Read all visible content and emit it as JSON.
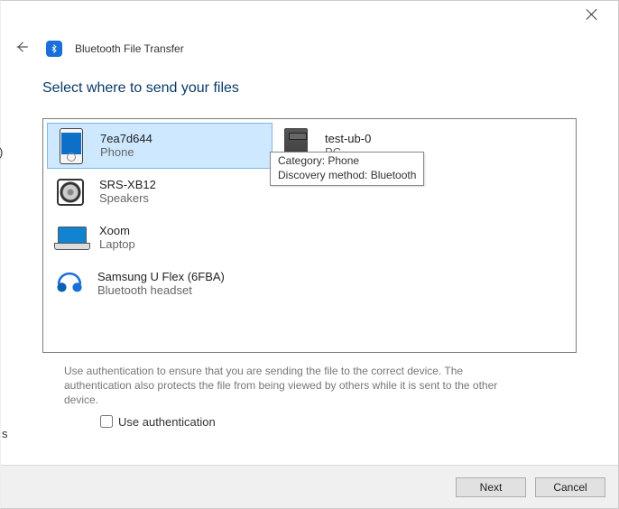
{
  "window_title": "Bluetooth File Transfer",
  "heading": "Select where to send your files",
  "devices": [
    {
      "name": "7ea7d644",
      "type": "Phone",
      "icon": "phone",
      "selected": true
    },
    {
      "name": "SRS-XB12",
      "type": "Speakers",
      "icon": "speaker",
      "selected": false
    },
    {
      "name": "Xoom",
      "type": "Laptop",
      "icon": "laptop",
      "selected": false
    },
    {
      "name": "Samsung U Flex (6FBA)",
      "type": "Bluetooth headset",
      "icon": "headset",
      "selected": false
    },
    {
      "name": "test-ub-0",
      "type": "PC",
      "icon": "pc",
      "selected": false
    }
  ],
  "tooltip": {
    "line1": "Category: Phone",
    "line2": "Discovery method: Bluetooth"
  },
  "help_text": "Use authentication to ensure that you are sending the file to the correct device. The authentication also protects the file from being viewed by others while it is sent to the other device.",
  "use_auth_label": "Use authentication",
  "use_auth_checked": false,
  "buttons": {
    "next": "Next",
    "cancel": "Cancel"
  },
  "left_clip": ")",
  "bottom_clip": "s"
}
